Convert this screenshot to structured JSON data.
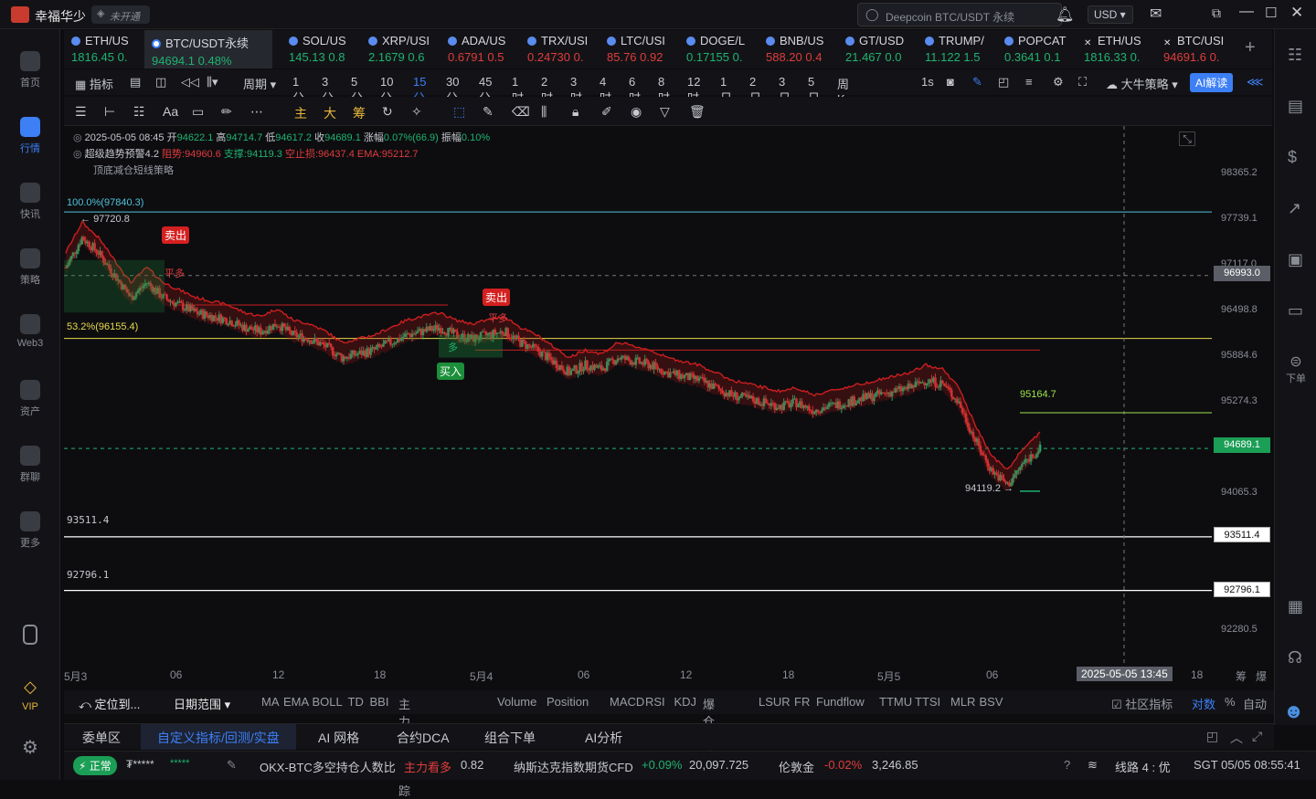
{
  "app": {
    "name": "幸福华少",
    "status": "未开通",
    "search_placeholder": "Deepcoin BTC/USDT 永续",
    "currency": "USD"
  },
  "nav": [
    {
      "label": "首页"
    },
    {
      "label": "行情"
    },
    {
      "label": "快讯"
    },
    {
      "label": "策略"
    },
    {
      "label": "Web3"
    },
    {
      "label": "资产"
    },
    {
      "label": "群聊"
    },
    {
      "label": "更多"
    },
    {
      "label": "VIP"
    }
  ],
  "tickers": [
    {
      "sym": "ETH/US",
      "price": "1816.45",
      "chg": "0."
    },
    {
      "sym": "BTC/USDT永续",
      "price": "94694.1",
      "chg": "0.48%"
    },
    {
      "sym": "SOL/US",
      "price": "145.13",
      "chg": "0.8"
    },
    {
      "sym": "XRP/USI",
      "price": "2.1679",
      "chg": "0.6"
    },
    {
      "sym": "ADA/US",
      "price": "0.6791",
      "chg": "0.5"
    },
    {
      "sym": "TRX/USI",
      "price": "0.24730",
      "chg": "0."
    },
    {
      "sym": "LTC/USI",
      "price": "85.76",
      "chg": "0.92"
    },
    {
      "sym": "DOGE/L",
      "price": "0.17155",
      "chg": "0."
    },
    {
      "sym": "BNB/US",
      "price": "588.20",
      "chg": "0.4"
    },
    {
      "sym": "GT/USD",
      "price": "21.467",
      "chg": "0.0"
    },
    {
      "sym": "TRUMP/",
      "price": "11.122",
      "chg": "1.5"
    },
    {
      "sym": "POPCAT",
      "price": "0.3641",
      "chg": "0.1"
    },
    {
      "sym": "ETH/US",
      "price": "1816.33",
      "chg": "0."
    },
    {
      "sym": "BTC/USI",
      "price": "94691.6",
      "chg": "0."
    }
  ],
  "intervals": {
    "indicator": "指标",
    "period": "周期",
    "list": [
      "1分",
      "3分",
      "5分",
      "10分",
      "15分",
      "30分",
      "45分",
      "1时",
      "2时",
      "3时",
      "4时",
      "6时",
      "8时",
      "12时",
      "1日",
      "2日",
      "3日",
      "5日",
      "周K"
    ],
    "active": "15分",
    "sec": "1s",
    "strategy": "大牛策略",
    "ai": "AI解读"
  },
  "drawtools": {
    "main": "主",
    "big": "大",
    "chip": "筹"
  },
  "ohlc": {
    "date": "2025-05-05 08:45",
    "open_l": "开",
    "open": "94622.1",
    "high_l": "高",
    "high": "94714.7",
    "low_l": "低",
    "low": "94617.2",
    "close_l": "收",
    "close": "94689.1",
    "chg_l": "涨幅",
    "chg": "0.07%(66.9)",
    "amp_l": "振幅",
    "amp": "0.10%"
  },
  "indicator_line": {
    "name": "超级趋势预警4.2",
    "resist": "阻势:94960.6",
    "support": "支撑:94119.3",
    "stop": "空止损:96437.4",
    "ema": "EMA:95212.7"
  },
  "strategy_line": "顶底减仓短线策略",
  "overlay": {
    "fib100": "100.0%(97840.3)",
    "fib53": "53.2%(96155.4)",
    "high_mark": "97720.8",
    "low_mark": "94119.2",
    "target": "95164.7",
    "sell": "卖出",
    "buy": "买入",
    "close_long": "平多",
    "close_short": "多",
    "line1": "93511.4",
    "line2": "92796.1"
  },
  "price_ticks": [
    "98365.2",
    "97739.1",
    "97117.0",
    "96498.8",
    "95884.6",
    "95274.3",
    "94065.3",
    "92280.5"
  ],
  "price_tags": {
    "cross": "96993.0",
    "last": "94689.1",
    "l1": "93511.4",
    "l2": "92796.1"
  },
  "time_ticks": [
    "5月3",
    "06",
    "12",
    "18",
    "5月4",
    "06",
    "12",
    "18",
    "5月5",
    "06",
    "18"
  ],
  "crosshair_time": "2025-05-05 13:45",
  "axis_ctrl": {
    "pct": "筹",
    "zoom": "爆"
  },
  "indicator_bar": {
    "locate": "定位到...",
    "range": "日期范围",
    "items": [
      "MA",
      "EMA",
      "BOLL",
      "TD",
      "BBI",
      "主力大单跟踪",
      "Volume",
      "Position",
      "MACD",
      "RSI",
      "KDJ",
      "爆仓统计",
      "LSUR",
      "FR",
      "Fundflow",
      "TTMU",
      "TTSI",
      "MLR",
      "BSV"
    ],
    "community": "社区指标",
    "log": "对数",
    "pct": "%",
    "auto": "自动"
  },
  "bottom_tabs": [
    "委单区",
    "自定义指标/回测/实盘",
    "AI 网格",
    "合约DCA",
    "组合下单",
    "AI分析"
  ],
  "status": {
    "state": "正常",
    "user": "₮*****",
    "mask": "*****",
    "news1": "OKX-BTC多空持仓人数比",
    "news1_tag": "主力看多",
    "news1_val": "0.82",
    "news2": "纳斯达克指数期货CFD",
    "news2_chg": "+0.09%",
    "news2_val": "20,097.725",
    "news3": "伦敦金",
    "news3_chg": "-0.02%",
    "news3_val": "3,246.85",
    "line": "线路 4 : 优",
    "time": "SGT 05/05 08:55:41"
  },
  "right_tools": {
    "order": "下单"
  },
  "colors": {
    "accent": "#3d7ff5",
    "up": "#1fb36f",
    "down": "#e03c3c",
    "fib100": "#4fc3d9",
    "fib53": "#e8d94a"
  },
  "chart_data": {
    "type": "candlestick",
    "symbol": "BTC/USDT永续",
    "interval": "15分",
    "ylim": [
      92000,
      98600
    ],
    "x_ticks": [
      "5月3",
      "06",
      "12",
      "18",
      "5月4",
      "06",
      "12",
      "18",
      "5月5",
      "06",
      "18"
    ],
    "close_path": [
      97100,
      97500,
      97300,
      97000,
      96700,
      96900,
      96700,
      96600,
      96500,
      96450,
      96400,
      96300,
      96250,
      96350,
      96200,
      96150,
      96050,
      95900,
      95950,
      96000,
      96100,
      96200,
      96250,
      96300,
      96200,
      96150,
      96200,
      96250,
      96100,
      96000,
      95850,
      95700,
      95800,
      95750,
      95900,
      95850,
      95800,
      95700,
      95650,
      95600,
      95500,
      95400,
      95350,
      95300,
      95250,
      95300,
      95200,
      95250,
      95300,
      95350,
      95400,
      95450,
      95500,
      95600,
      95550,
      95300,
      94800,
      94400,
      94200,
      94500,
      94689
    ]
  }
}
